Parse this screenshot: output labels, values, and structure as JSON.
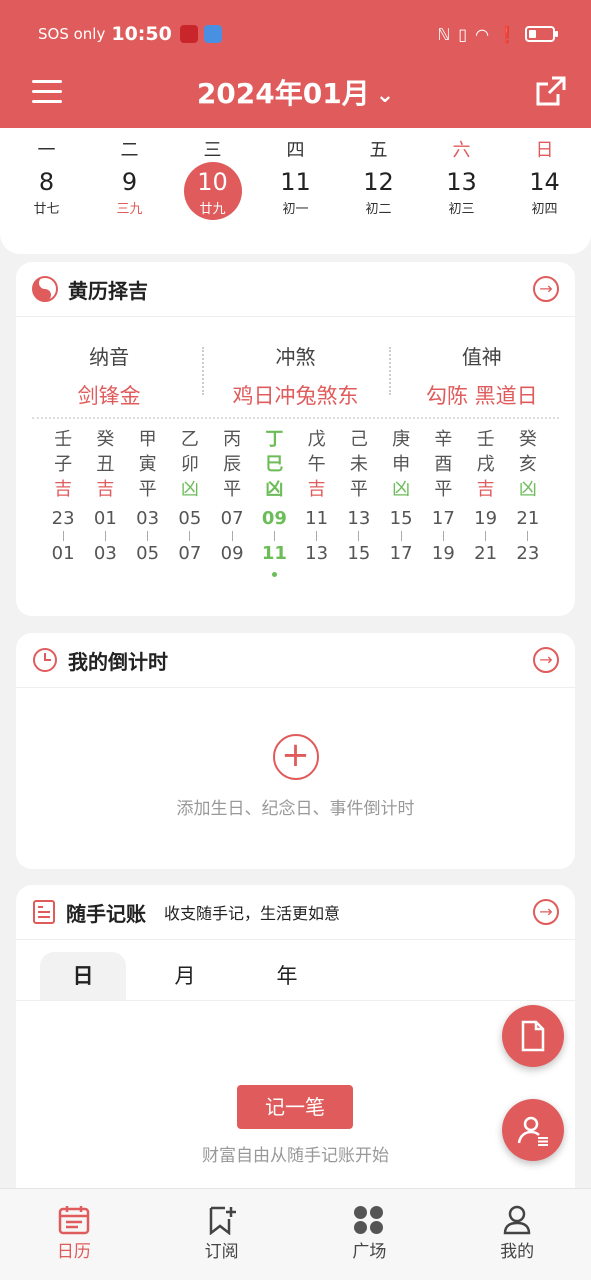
{
  "status_bar": {
    "carrier": "SOS only",
    "time": "10:50"
  },
  "header": {
    "title": "2024年01月"
  },
  "week": {
    "names": [
      "一",
      "二",
      "三",
      "四",
      "五",
      "六",
      "日"
    ],
    "days": [
      {
        "num": "8",
        "lunar": "廿七"
      },
      {
        "num": "9",
        "lunar": "三九"
      },
      {
        "num": "10",
        "lunar": "廿九"
      },
      {
        "num": "11",
        "lunar": "初一"
      },
      {
        "num": "12",
        "lunar": "初二"
      },
      {
        "num": "13",
        "lunar": "初三"
      },
      {
        "num": "14",
        "lunar": "初四"
      }
    ]
  },
  "huangli": {
    "title": "黄历择吉",
    "nayin_label": "纳音",
    "nayin_value": "剑锋金",
    "chongsha_label": "冲煞",
    "chongsha_value": "鸡日冲兔煞东",
    "zhishen_label": "值神",
    "zhishen_value": "勾陈 黑道日",
    "hours": [
      {
        "g": "壬",
        "z": "子",
        "luck": "吉",
        "s": "23",
        "e": "01"
      },
      {
        "g": "癸",
        "z": "丑",
        "luck": "吉",
        "s": "01",
        "e": "03"
      },
      {
        "g": "甲",
        "z": "寅",
        "luck": "平",
        "s": "03",
        "e": "05"
      },
      {
        "g": "乙",
        "z": "卯",
        "luck": "凶",
        "s": "05",
        "e": "07"
      },
      {
        "g": "丙",
        "z": "辰",
        "luck": "平",
        "s": "07",
        "e": "09"
      },
      {
        "g": "丁",
        "z": "巳",
        "luck": "凶",
        "s": "09",
        "e": "11"
      },
      {
        "g": "戊",
        "z": "午",
        "luck": "吉",
        "s": "11",
        "e": "13"
      },
      {
        "g": "己",
        "z": "未",
        "luck": "平",
        "s": "13",
        "e": "15"
      },
      {
        "g": "庚",
        "z": "申",
        "luck": "凶",
        "s": "15",
        "e": "17"
      },
      {
        "g": "辛",
        "z": "酉",
        "luck": "平",
        "s": "17",
        "e": "19"
      },
      {
        "g": "壬",
        "z": "戌",
        "luck": "吉",
        "s": "19",
        "e": "21"
      },
      {
        "g": "癸",
        "z": "亥",
        "luck": "凶",
        "s": "21",
        "e": "23"
      }
    ]
  },
  "countdown": {
    "title": "我的倒计时",
    "hint": "添加生日、纪念日、事件倒计时"
  },
  "bookkeeping": {
    "title": "随手记账",
    "subtitle": "收支随手记，生活更如意",
    "tabs": [
      "日",
      "月",
      "年"
    ],
    "record_label": "记一笔",
    "hint": "财富自由从随手记账开始"
  },
  "nav": [
    "日历",
    "订阅",
    "广场",
    "我的"
  ],
  "colors": {
    "accent": "#e05c5c",
    "green": "#6cbd58"
  }
}
